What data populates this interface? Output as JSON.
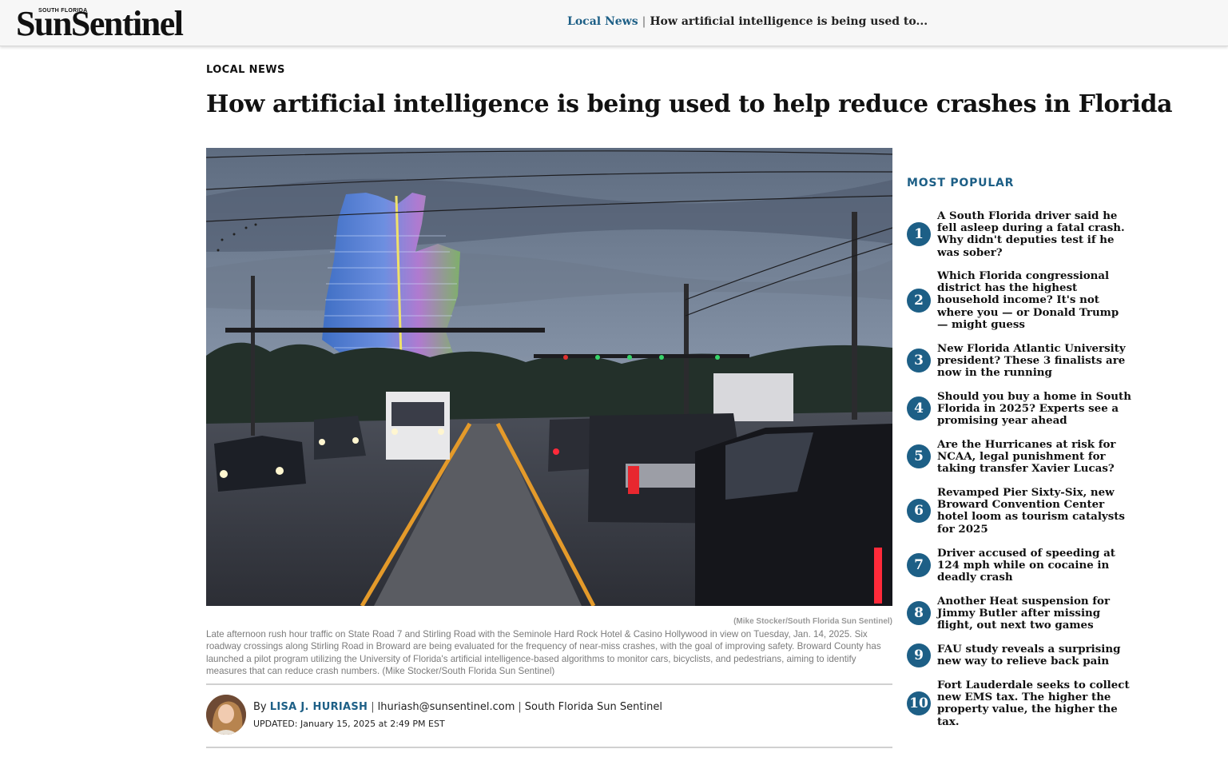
{
  "header": {
    "logo_small": "SOUTH FLORIDA",
    "logo_main": "SunSentinel",
    "breadcrumb_section": "Local News",
    "breadcrumb_separator": "|",
    "breadcrumb_title": "How artificial intelligence is being used to..."
  },
  "article": {
    "kicker": "LOCAL NEWS",
    "headline": "How artificial intelligence is being used to help reduce crashes in Florida",
    "photo_credit": "(Mike Stocker/South Florida Sun Sentinel)",
    "caption": "Late afternoon rush hour traffic on State Road 7 and Stirling Road with the Seminole Hard Rock Hotel & Casino Hollywood in view on Tuesday, Jan. 14, 2025. Six roadway crossings along Stirling Road in Broward are being evaluated for the frequency of near-miss crashes, with the goal of improving safety. Broward County has launched a pilot program utilizing the University of Florida's artificial intelligence-based algorithms to monitor cars, bicyclists, and pedestrians, aiming to identify measures that can reduce crash numbers. (Mike Stocker/South Florida Sun Sentinel)",
    "byline_prefix": "By",
    "author": "LISA J. HURIASH",
    "separator": "|",
    "email": "lhuriash@sunsentinel.com",
    "publication": "South Florida Sun Sentinel",
    "updated": "UPDATED: January 15, 2025 at 2:49 PM EST"
  },
  "sidebar": {
    "title": "MOST POPULAR",
    "items": [
      {
        "num": "1",
        "text": "A South Florida driver said he fell asleep during a fatal crash. Why didn't deputies test if he was sober?"
      },
      {
        "num": "2",
        "text": "Which Florida congressional district has the highest household income? It's not where you — or Donald Trump — might guess"
      },
      {
        "num": "3",
        "text": "New Florida Atlantic University president? These 3 finalists are now in the running"
      },
      {
        "num": "4",
        "text": "Should you buy a home in South Florida in 2025? Experts see a promising year ahead"
      },
      {
        "num": "5",
        "text": "Are the Hurricanes at risk for NCAA, legal punishment for taking transfer Xavier Lucas?"
      },
      {
        "num": "6",
        "text": "Revamped Pier Sixty-Six, new Broward Convention Center hotel loom as tourism catalysts for 2025"
      },
      {
        "num": "7",
        "text": "Driver accused of speeding at 124 mph while on cocaine in deadly crash"
      },
      {
        "num": "8",
        "text": "Another Heat suspension for Jimmy Butler after missing flight, out next two games"
      },
      {
        "num": "9",
        "text": "FAU study reveals a surprising new way to relieve back pain"
      },
      {
        "num": "10",
        "text": "Fort Lauderdale seeks to collect new EMS tax. The higher the property value, the higher the tax."
      }
    ]
  }
}
